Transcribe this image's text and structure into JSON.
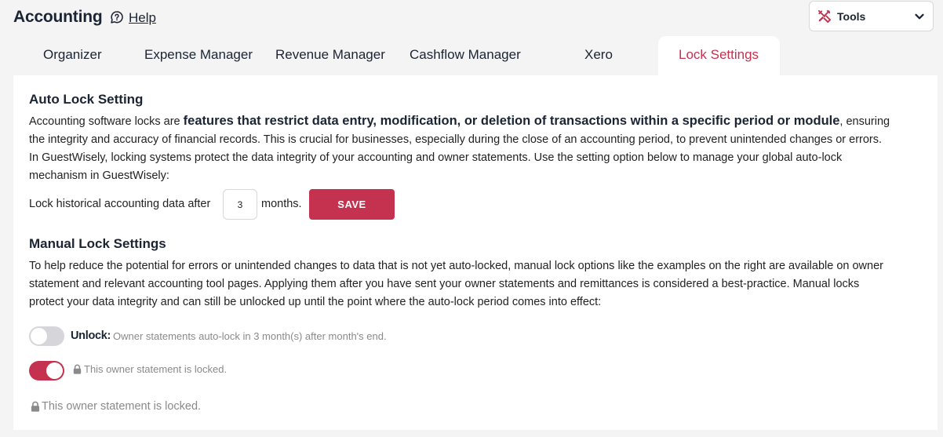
{
  "header": {
    "title": "Accounting",
    "help_label": "Help",
    "help_icon": "chat-question-icon",
    "tools_label": "Tools",
    "tools_icon": "tools-icon",
    "tools_chevron_icon": "chevron-down-icon"
  },
  "tabs": [
    {
      "label": "Organizer",
      "active": false
    },
    {
      "label": "Expense Manager",
      "active": false
    },
    {
      "label": "Revenue Manager",
      "active": false
    },
    {
      "label": "Cashflow Manager",
      "active": false
    },
    {
      "label": "Xero",
      "active": false
    },
    {
      "label": "Lock Settings",
      "active": true
    }
  ],
  "auto_lock": {
    "heading": "Auto Lock Setting",
    "desc_prefix": "Accounting software locks are ",
    "desc_bold": "features that restrict data entry, modification, or deletion of transactions within a specific period or module",
    "desc_suffix": ", ensuring",
    "desc_line2": "the integrity and accuracy of financial records. This is crucial for businesses, especially during the close of an accounting period, to prevent unintended changes or errors.",
    "desc_line3": "In GuestWisely, locking systems protect the data integrity of your accounting and owner statements. Use the setting option below to manage your global auto-lock",
    "desc_line4": "mechanism in GuestWisely:",
    "lock_label": "Lock historical accounting data after",
    "months_value": "3",
    "months_label": "months.",
    "save_label": "SAVE"
  },
  "manual_lock": {
    "heading": "Manual Lock Settings",
    "desc_line1": "To help reduce the potential for errors or unintended changes to data that is not yet auto-locked, manual lock options like the examples on the right are available on owner",
    "desc_line2": "statement and relevant accounting tool pages. Applying them after you have sent your owner statements and remittances is considered a best-practice. Manual locks",
    "desc_line3": "protect your data integrity and can still be unlocked up until the point where the auto-lock period comes into effect:",
    "example_unlock_strong": "Unlock:",
    "example_unlock_text": "Owner statements auto-lock in 3 month(s) after month's end.",
    "example_locked_text": "This owner statement is locked.",
    "locked_notice": "This owner statement is locked."
  },
  "colors": {
    "accent": "#c4324f",
    "text_dark": "#1b2433",
    "muted": "#8a8a8a",
    "page_bg": "#f4f4f5"
  }
}
